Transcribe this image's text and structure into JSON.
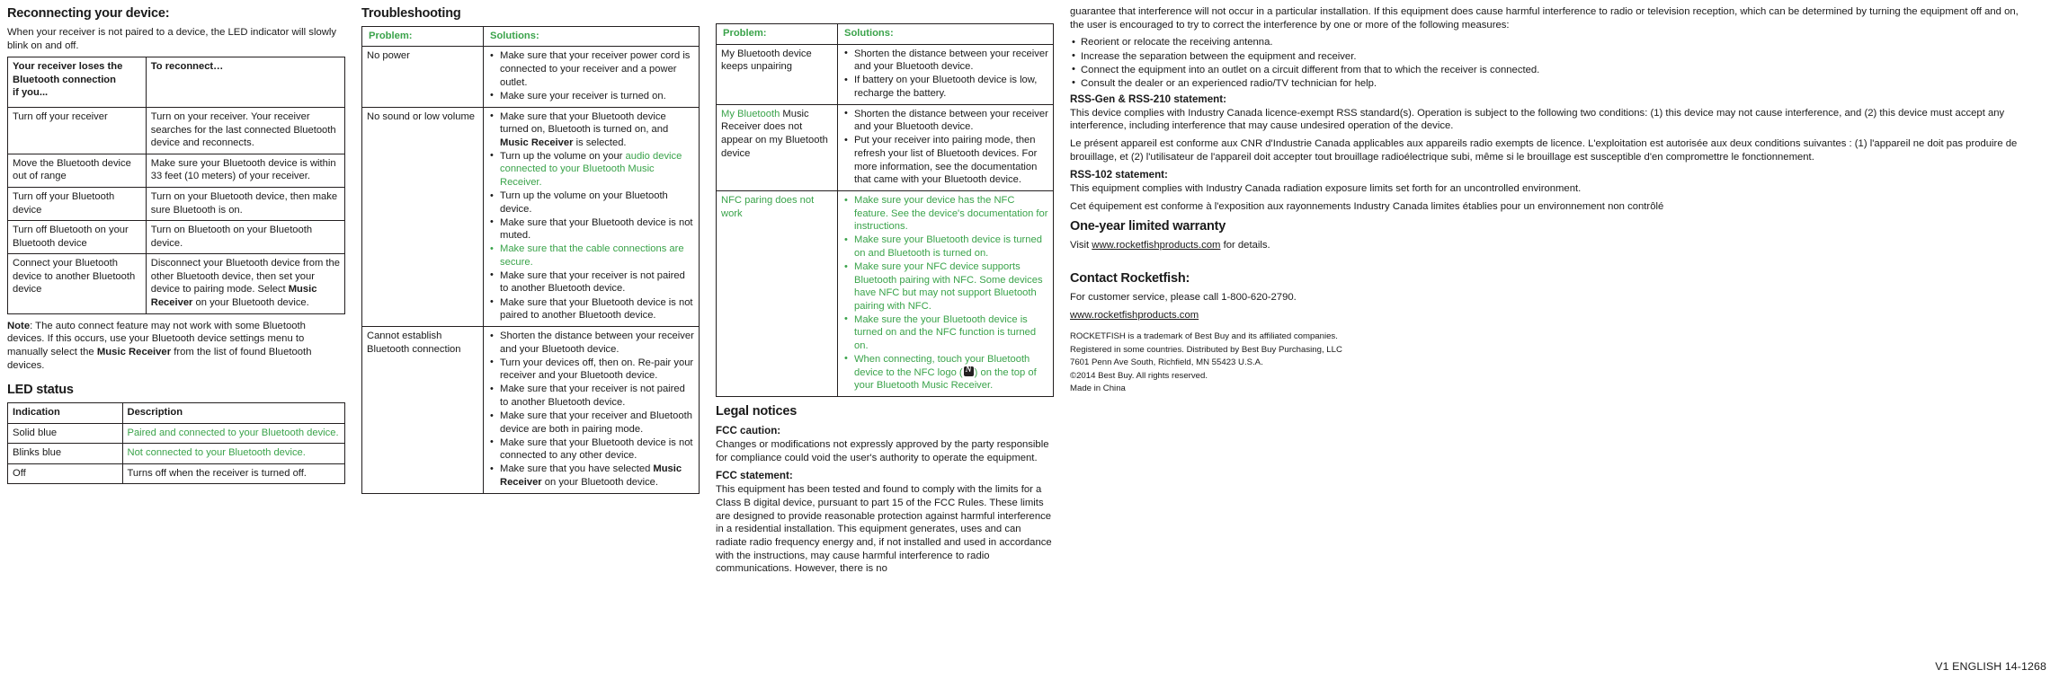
{
  "meta": {
    "version_footer": "V1 ENGLISH 14-1268",
    "accent_green": "#3aa34a",
    "ink": "#231f20"
  },
  "column1": {
    "reconnect": {
      "heading": "Reconnecting your device:",
      "intro": "When your receiver is not paired to a device, the LED indicator will slowly blink on and off.",
      "table": {
        "headers": [
          "Your receiver loses the Bluetooth connection if you...",
          "To reconnect…"
        ],
        "header_left_lines": [
          "Your receiver loses the",
          "Bluetooth connection",
          "if you..."
        ],
        "rows": [
          {
            "cause": "Turn off your receiver",
            "fix_parts": [
              {
                "text": "Turn on your receiver. Your receiver searches for the last connected Bluetooth device and reconnects.",
                "bold": false
              }
            ]
          },
          {
            "cause": "Move the Bluetooth device out of range",
            "fix_parts": [
              {
                "text": "Make sure your Bluetooth device is within 33 feet (10 meters) of your receiver.",
                "bold": false
              }
            ]
          },
          {
            "cause": "Turn off your Bluetooth device",
            "fix_parts": [
              {
                "text": "Turn on your Bluetooth device, then make sure Bluetooth is on.",
                "bold": false
              }
            ]
          },
          {
            "cause": "Turn off Bluetooth on your Bluetooth device",
            "fix_parts": [
              {
                "text": "Turn on Bluetooth on your Bluetooth device.",
                "bold": false
              }
            ]
          },
          {
            "cause": "Connect your Bluetooth device to another Bluetooth device",
            "fix_parts": [
              {
                "text": "Disconnect your Bluetooth device from the other Bluetooth device, then set your device to pairing mode. Select ",
                "bold": false
              },
              {
                "text": "Music Receiver",
                "bold": true
              },
              {
                "text": " on your Bluetooth device.",
                "bold": false
              }
            ]
          }
        ]
      },
      "note_label": "Note",
      "note_pre": ": The auto connect feature may not work with some Bluetooth devices. If this occurs, use your Bluetooth device settings menu to manually select the ",
      "note_bold": "Music Receiver",
      "note_post": " from the list of found Bluetooth devices."
    },
    "led": {
      "heading": "LED status",
      "headers": [
        "Indication",
        "Description"
      ],
      "rows": [
        {
          "indication": "Solid blue",
          "description": "Paired and connected to your Bluetooth device.",
          "green": true
        },
        {
          "indication": "Blinks blue",
          "description": "Not connected to your Bluetooth device.",
          "green": true
        },
        {
          "indication": "Off",
          "description": "Turns off when the receiver is turned off.",
          "green": false
        }
      ]
    }
  },
  "column2": {
    "heading": "Troubleshooting",
    "headers": [
      "Problem:",
      "Solutions:"
    ],
    "rows": [
      {
        "problem": "No power",
        "problem_green": false,
        "solutions": [
          {
            "green": false,
            "parts": [
              {
                "text": "Make sure that your receiver power cord is connected to your receiver and a power outlet.",
                "bold": false
              }
            ]
          },
          {
            "green": false,
            "parts": [
              {
                "text": "Make sure your receiver is turned on.",
                "bold": false
              }
            ]
          }
        ]
      },
      {
        "problem": "No sound or low volume",
        "problem_green": false,
        "solutions": [
          {
            "green": false,
            "parts": [
              {
                "text": "Make sure that your Bluetooth device turned on, Bluetooth is turned on, and ",
                "bold": false
              },
              {
                "text": "Music Receiver",
                "bold": true
              },
              {
                "text": " is selected.",
                "bold": false
              }
            ]
          },
          {
            "green": false,
            "parts": [
              {
                "text": "Turn up the volume on your ",
                "bold": false
              },
              {
                "text": "audio device connected to your Bluetooth Music Receiver.",
                "bold": false,
                "green": true
              }
            ]
          },
          {
            "green": false,
            "parts": [
              {
                "text": "Turn up the volume on your Bluetooth device.",
                "bold": false
              }
            ]
          },
          {
            "green": false,
            "parts": [
              {
                "text": "Make sure that your Bluetooth device is not muted.",
                "bold": false
              }
            ]
          },
          {
            "green": true,
            "parts": [
              {
                "text": "Make sure that the cable connections are secure.",
                "bold": false
              }
            ]
          },
          {
            "green": false,
            "parts": [
              {
                "text": "Make sure that your receiver is not paired to another Bluetooth device.",
                "bold": false
              }
            ]
          },
          {
            "green": false,
            "parts": [
              {
                "text": "Make sure that your Bluetooth device is not paired to another Bluetooth device.",
                "bold": false
              }
            ]
          }
        ]
      },
      {
        "problem": "Cannot establish Bluetooth connection",
        "problem_green": false,
        "solutions": [
          {
            "green": false,
            "parts": [
              {
                "text": "Shorten the distance between your receiver and your Bluetooth device.",
                "bold": false
              }
            ]
          },
          {
            "green": false,
            "parts": [
              {
                "text": "Turn your devices off, then on. Re-pair your receiver and your Bluetooth device.",
                "bold": false
              }
            ]
          },
          {
            "green": false,
            "parts": [
              {
                "text": "Make sure that your receiver is not paired to another Bluetooth device.",
                "bold": false
              }
            ]
          },
          {
            "green": false,
            "parts": [
              {
                "text": "Make sure that your receiver and Bluetooth device are both in pairing mode.",
                "bold": false
              }
            ]
          },
          {
            "green": false,
            "parts": [
              {
                "text": "Make sure that your Bluetooth device is not connected to any other device.",
                "bold": false
              }
            ]
          },
          {
            "green": false,
            "parts": [
              {
                "text": "Make sure that you have selected ",
                "bold": false
              },
              {
                "text": "Music Receiver",
                "bold": true
              },
              {
                "text": " on your Bluetooth device.",
                "bold": false
              }
            ]
          }
        ]
      }
    ]
  },
  "column3": {
    "headers": [
      "Problem:",
      "Solutions:"
    ],
    "rows": [
      {
        "problem_parts": [
          {
            "text": "My Bluetooth device keeps unpairing",
            "green": false
          }
        ],
        "solutions": [
          {
            "green": false,
            "parts": [
              {
                "text": "Shorten the distance between your receiver  and your Bluetooth device.",
                "bold": false
              }
            ]
          },
          {
            "green": false,
            "parts": [
              {
                "text": "If battery on your Bluetooth device is low, recharge the battery.",
                "bold": false
              }
            ]
          }
        ]
      },
      {
        "problem_parts": [
          {
            "text": "My Bluetooth",
            "green": true
          },
          {
            "text": " Music Receiver does not appear on my Bluetooth device",
            "green": false
          }
        ],
        "solutions": [
          {
            "green": false,
            "parts": [
              {
                "text": "Shorten the distance between your receiver  and your Bluetooth device.",
                "bold": false
              }
            ]
          },
          {
            "green": false,
            "parts": [
              {
                "text": "Put your receiver into pairing mode, then refresh your list of Bluetooth devices. For more information, see the documentation that came with your Bluetooth device.",
                "bold": false
              }
            ]
          }
        ]
      },
      {
        "problem_parts": [
          {
            "text": "NFC paring does not work",
            "green": true
          }
        ],
        "solutions": [
          {
            "green": true,
            "parts": [
              {
                "text": "Make sure your device has the NFC feature.  See the device's documentation for instructions.",
                "bold": false
              }
            ]
          },
          {
            "green": true,
            "parts": [
              {
                "text": "Make sure your Bluetooth device is turned on and Bluetooth is turned on.",
                "bold": false
              }
            ]
          },
          {
            "green": true,
            "parts": [
              {
                "text": "Make sure your NFC device supports Bluetooth pairing with NFC. Some devices have NFC but may not support Bluetooth pairing with NFC.",
                "bold": false
              }
            ]
          },
          {
            "green": true,
            "parts": [
              {
                "text": "Make sure the your Bluetooth device is turned on and the NFC function is turned on.",
                "bold": false
              }
            ]
          },
          {
            "green": true,
            "nfc": true,
            "parts": [
              {
                "text": "When connecting, touch your Bluetooth device to the NFC logo (",
                "bold": false
              },
              {
                "text": "NFC_LOGO",
                "icon": true
              },
              {
                "text": ") on the top of your Bluetooth Music Receiver.",
                "bold": false
              }
            ]
          }
        ]
      }
    ],
    "legal": {
      "heading": "Legal notices",
      "fcc_caution_title": "FCC caution:",
      "fcc_caution_body": "Changes or modifications not expressly approved by the party responsible for compliance could void the user's authority to operate the equipment.",
      "fcc_statement_title": "FCC statement:",
      "fcc_statement_body": "This equipment has been tested and found to comply with the limits for a Class B digital device, pursuant to part 15 of the FCC Rules. These limits are designed to provide reasonable protection against harmful interference in a residential installation. This equipment generates, uses and can radiate radio frequency energy and, if not installed and used in accordance with the instructions, may cause harmful interference to radio communications. However, there is no"
    }
  },
  "column4": {
    "fcc_continued": "guarantee that interference will not occur in a particular installation. If this equipment does cause harmful interference to radio or television reception, which can be determined by turning the equipment off and on, the user is encouraged to try to correct the interference by one or more of the following measures:",
    "fcc_measures": [
      "Reorient or relocate the receiving antenna.",
      "Increase the separation between the equipment and receiver.",
      "Connect the equipment into an outlet on a circuit different from that to which the receiver is connected.",
      "Consult the dealer or an experienced radio/TV technician for help."
    ],
    "rss_gen_title": "RSS-Gen & RSS-210 statement:",
    "rss_gen_en": "This device complies with Industry Canada licence-exempt RSS standard(s). Operation is subject to the following two conditions: (1) this device may not cause interference, and (2) this device must accept any interference, including interference that may cause undesired operation of the device.",
    "rss_gen_fr": "Le présent appareil est conforme aux CNR d'Industrie Canada applicables aux appareils radio exempts de licence. L'exploitation est autorisée aux deux conditions suivantes : (1) l'appareil ne doit pas produire de brouillage, et (2) l'utilisateur de l'appareil doit accepter tout brouillage radioélectrique subi, même si le brouillage est susceptible d'en compromettre le fonctionnement.",
    "rss102_title": "RSS-102 statement:",
    "rss102_en": "This equipment complies with Industry Canada radiation exposure limits set forth for an uncontrolled environment.",
    "rss102_fr": "Cet équipement est conforme à l'exposition aux rayonnements Industry Canada limites établies pour un environnement non contrôlé",
    "warranty_title": "One-year limited warranty",
    "warranty_pre": "Visit ",
    "warranty_link": "www.rocketfishproducts.com",
    "warranty_post": " for details.",
    "contact_title": "Contact Rocketfish:",
    "contact_phone": "For customer service, please call 1-800-620-2790.",
    "contact_link": "www.rocketfishproducts.com",
    "fine_print": [
      "ROCKETFISH is a trademark of Best Buy and its affiliated companies.",
      "Registered in some countries. Distributed by Best Buy Purchasing, LLC",
      "7601 Penn Ave South, Richfield, MN 55423 U.S.A.",
      "©2014 Best Buy. All rights reserved.",
      "Made in China"
    ]
  }
}
